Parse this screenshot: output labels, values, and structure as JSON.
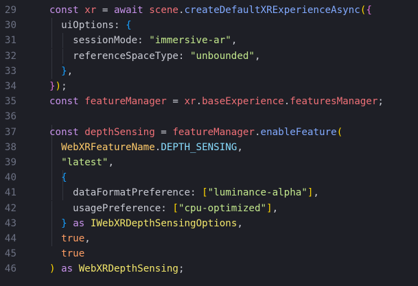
{
  "editor": {
    "language": "typescript",
    "colors": {
      "background": "#1e1f26",
      "line_number": "#6c7183",
      "keyword": "#c792ea",
      "function": "#82aaff",
      "string": "#c3e88d",
      "variable": "#f07178",
      "type": "#ffcb6b",
      "bracket_gold": "#ffd700",
      "bracket_orchid": "#da70d6",
      "bracket_blue": "#179fff"
    },
    "lines": [
      {
        "number": "29",
        "tokens": [
          {
            "text": "const",
            "kind": "k"
          },
          {
            "text": " ",
            "kind": "p"
          },
          {
            "text": "xr",
            "kind": "v"
          },
          {
            "text": " = ",
            "kind": "p"
          },
          {
            "text": "await",
            "kind": "k"
          },
          {
            "text": " ",
            "kind": "p"
          },
          {
            "text": "scene",
            "kind": "v"
          },
          {
            "text": ".",
            "kind": "p"
          },
          {
            "text": "createDefaultXRExperienceAsync",
            "kind": "fn"
          },
          {
            "text": "(",
            "kind": "b1"
          },
          {
            "text": "{",
            "kind": "b2"
          }
        ]
      },
      {
        "number": "30",
        "tokens": [
          {
            "text": "  uiOptions",
            "kind": "prop"
          },
          {
            "text": ": ",
            "kind": "p"
          },
          {
            "text": "{",
            "kind": "b3"
          }
        ]
      },
      {
        "number": "31",
        "tokens": [
          {
            "text": "    sessionMode",
            "kind": "prop"
          },
          {
            "text": ": ",
            "kind": "p"
          },
          {
            "text": "\"immersive-ar\"",
            "kind": "s"
          },
          {
            "text": ",",
            "kind": "p"
          }
        ]
      },
      {
        "number": "32",
        "tokens": [
          {
            "text": "    referenceSpaceType",
            "kind": "prop"
          },
          {
            "text": ": ",
            "kind": "p"
          },
          {
            "text": "\"unbounded\"",
            "kind": "s"
          },
          {
            "text": ",",
            "kind": "p"
          }
        ]
      },
      {
        "number": "33",
        "tokens": [
          {
            "text": "  ",
            "kind": "p"
          },
          {
            "text": "}",
            "kind": "b3"
          },
          {
            "text": ",",
            "kind": "p"
          }
        ]
      },
      {
        "number": "34",
        "tokens": [
          {
            "text": "}",
            "kind": "b2"
          },
          {
            "text": ")",
            "kind": "b1"
          },
          {
            "text": ";",
            "kind": "p"
          }
        ]
      },
      {
        "number": "35",
        "tokens": [
          {
            "text": "const",
            "kind": "k"
          },
          {
            "text": " ",
            "kind": "p"
          },
          {
            "text": "featureManager",
            "kind": "v"
          },
          {
            "text": " = ",
            "kind": "p"
          },
          {
            "text": "xr",
            "kind": "v"
          },
          {
            "text": ".",
            "kind": "p"
          },
          {
            "text": "baseExperience",
            "kind": "v"
          },
          {
            "text": ".",
            "kind": "p"
          },
          {
            "text": "featuresManager",
            "kind": "v"
          },
          {
            "text": ";",
            "kind": "p"
          }
        ]
      },
      {
        "number": "36",
        "tokens": []
      },
      {
        "number": "37",
        "tokens": [
          {
            "text": "const",
            "kind": "k"
          },
          {
            "text": " ",
            "kind": "p"
          },
          {
            "text": "depthSensing",
            "kind": "v"
          },
          {
            "text": " = ",
            "kind": "p"
          },
          {
            "text": "featureManager",
            "kind": "v"
          },
          {
            "text": ".",
            "kind": "p"
          },
          {
            "text": "enableFeature",
            "kind": "fn"
          },
          {
            "text": "(",
            "kind": "b1"
          }
        ]
      },
      {
        "number": "38",
        "tokens": [
          {
            "text": "  ",
            "kind": "p"
          },
          {
            "text": "WebXRFeatureName",
            "kind": "ty"
          },
          {
            "text": ".",
            "kind": "p"
          },
          {
            "text": "DEPTH_SENSING",
            "kind": "const"
          },
          {
            "text": ",",
            "kind": "p"
          }
        ]
      },
      {
        "number": "39",
        "tokens": [
          {
            "text": "  ",
            "kind": "p"
          },
          {
            "text": "\"latest\"",
            "kind": "s"
          },
          {
            "text": ",",
            "kind": "p"
          }
        ]
      },
      {
        "number": "40",
        "tokens": [
          {
            "text": "  ",
            "kind": "p"
          },
          {
            "text": "{",
            "kind": "b3"
          }
        ]
      },
      {
        "number": "41",
        "tokens": [
          {
            "text": "    dataFormatPreference",
            "kind": "prop"
          },
          {
            "text": ": ",
            "kind": "p"
          },
          {
            "text": "[",
            "kind": "b1"
          },
          {
            "text": "\"luminance-alpha\"",
            "kind": "s"
          },
          {
            "text": "]",
            "kind": "b1"
          },
          {
            "text": ",",
            "kind": "p"
          }
        ]
      },
      {
        "number": "42",
        "tokens": [
          {
            "text": "    usagePreference",
            "kind": "prop"
          },
          {
            "text": ": ",
            "kind": "p"
          },
          {
            "text": "[",
            "kind": "b1"
          },
          {
            "text": "\"cpu-optimized\"",
            "kind": "s"
          },
          {
            "text": "]",
            "kind": "b1"
          },
          {
            "text": ",",
            "kind": "p"
          }
        ]
      },
      {
        "number": "43",
        "tokens": [
          {
            "text": "  ",
            "kind": "p"
          },
          {
            "text": "}",
            "kind": "b3"
          },
          {
            "text": " ",
            "kind": "p"
          },
          {
            "text": "as",
            "kind": "k"
          },
          {
            "text": " ",
            "kind": "p"
          },
          {
            "text": "IWebXRDepthSensingOptions",
            "kind": "typeref"
          },
          {
            "text": ",",
            "kind": "p"
          }
        ]
      },
      {
        "number": "44",
        "tokens": [
          {
            "text": "  ",
            "kind": "p"
          },
          {
            "text": "true",
            "kind": "n"
          },
          {
            "text": ",",
            "kind": "p"
          }
        ]
      },
      {
        "number": "45",
        "tokens": [
          {
            "text": "  ",
            "kind": "p"
          },
          {
            "text": "true",
            "kind": "n"
          }
        ]
      },
      {
        "number": "46",
        "tokens": [
          {
            "text": ")",
            "kind": "b1"
          },
          {
            "text": " ",
            "kind": "p"
          },
          {
            "text": "as",
            "kind": "k"
          },
          {
            "text": " ",
            "kind": "p"
          },
          {
            "text": "WebXRDepthSensing",
            "kind": "typeref"
          },
          {
            "text": ";",
            "kind": "p"
          }
        ]
      }
    ]
  }
}
